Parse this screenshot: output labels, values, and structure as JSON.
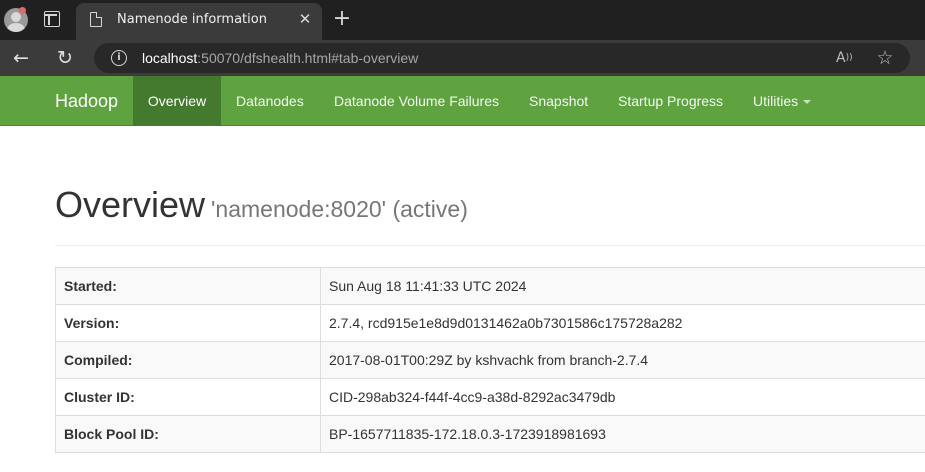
{
  "browser": {
    "tab_title": "Namenode information",
    "tab_close": "✕",
    "new_tab": "+",
    "url_host": "localhost",
    "url_rest": ":50070/dfshealth.html#tab-overview",
    "icons": [
      "profile-avatar-icon",
      "tab-actions-icon",
      "page-icon",
      "close-icon",
      "plus-icon",
      "back-arrow-icon",
      "reload-icon",
      "info-icon",
      "read-aloud-icon",
      "star-icon"
    ]
  },
  "navbar": {
    "brand": "Hadoop",
    "items": [
      {
        "label": "Overview",
        "active": true
      },
      {
        "label": "Datanodes",
        "active": false
      },
      {
        "label": "Datanode Volume Failures",
        "active": false
      },
      {
        "label": "Snapshot",
        "active": false
      },
      {
        "label": "Startup Progress",
        "active": false
      },
      {
        "label": "Utilities",
        "active": false,
        "dropdown": true
      }
    ],
    "colors": {
      "bar": "#5fa341",
      "active": "#447a2e"
    }
  },
  "overview": {
    "title": "Overview",
    "subtitle": "'namenode:8020' (active)",
    "rows": [
      {
        "label": "Started:",
        "value": "Sun Aug 18 11:41:33 UTC 2024"
      },
      {
        "label": "Version:",
        "value": "2.7.4, rcd915e1e8d9d0131462a0b7301586c175728a282"
      },
      {
        "label": "Compiled:",
        "value": "2017-08-01T00:29Z by kshvachk from branch-2.7.4"
      },
      {
        "label": "Cluster ID:",
        "value": "CID-298ab324-f44f-4cc9-a38d-8292ac3479db"
      },
      {
        "label": "Block Pool ID:",
        "value": "BP-1657711835-172.18.0.3-1723918981693"
      }
    ]
  }
}
